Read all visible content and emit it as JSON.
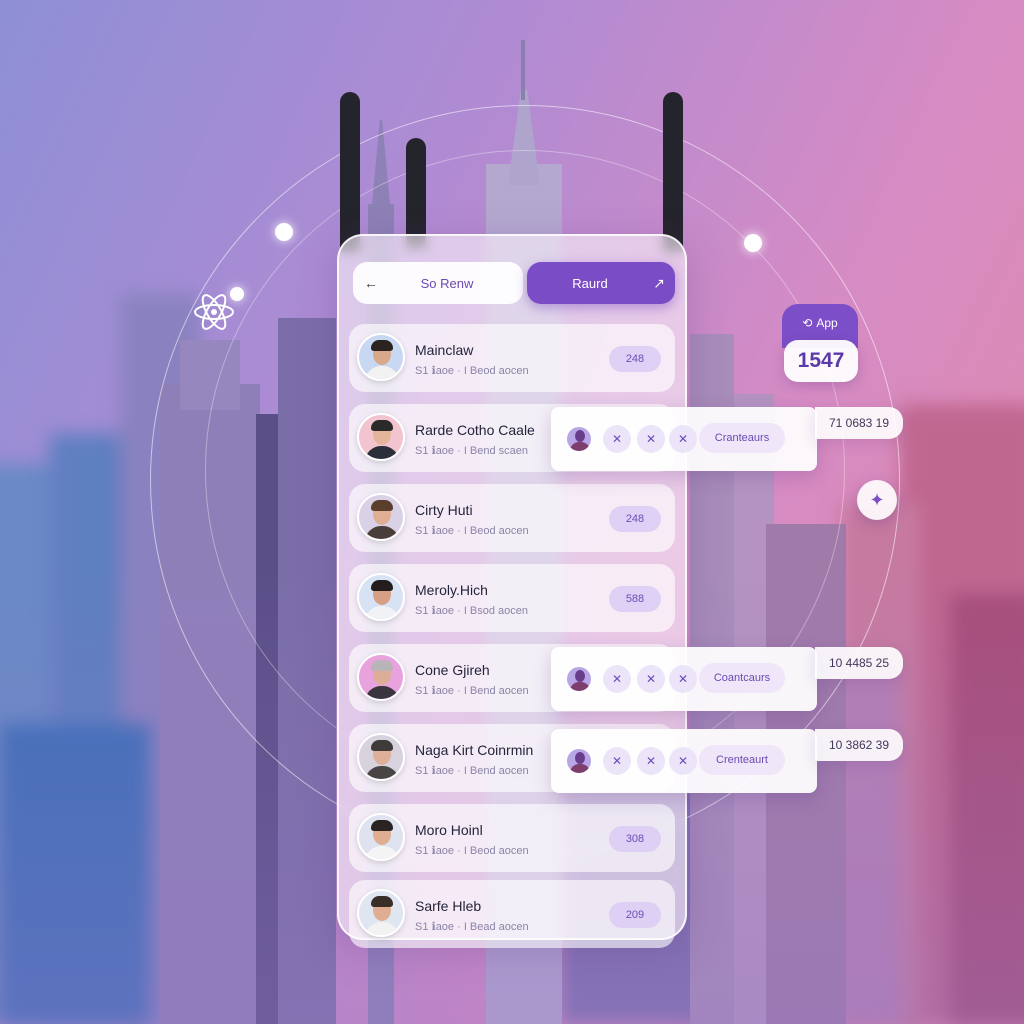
{
  "topbar": {
    "search_icon": "←",
    "search_label": "So Renw",
    "action_label": "Raurd",
    "action_icon": "↗"
  },
  "contacts": [
    {
      "name": "Mainclaw",
      "sub": "S1 ℹaoe · I Beod aocen",
      "badge": "248",
      "avatar_bg": "#c8d8f2",
      "hair": "#2b2320",
      "shirt": "#f2f2f2",
      "skin": "#d9a88a"
    },
    {
      "name": "Rarde Cotho Caale",
      "sub": "S1 ℹaoe · I Bend scaen",
      "badge": "",
      "avatar_bg": "#f1c4cf",
      "hair": "#2a2a2a",
      "shirt": "#2c2e3a",
      "skin": "#e4b59a"
    },
    {
      "name": "Cirty Huti",
      "sub": "S1 ℹaoe · I Beod aocen",
      "badge": "248",
      "avatar_bg": "#d9d2e6",
      "hair": "#5b3f2c",
      "shirt": "#4a3e3a",
      "skin": "#e0ae94"
    },
    {
      "name": "Meroly.Hich",
      "sub": "S1 ℹaoe · I Bsod aocen",
      "badge": "588",
      "avatar_bg": "#d7e3f4",
      "hair": "#231e1d",
      "shirt": "#f1f2f6",
      "skin": "#d7a084"
    },
    {
      "name": "Cone Gjireh",
      "sub": "S1 ℹaoe · I Bend aocen",
      "badge": "",
      "avatar_bg": "#e8a2dd",
      "hair": "#b9b4b7",
      "shirt": "#3b3540",
      "skin": "#dcae98"
    },
    {
      "name": "Naga Kirt Coinrmin",
      "sub": "S1 ℹaoe · I Bend aocen",
      "badge": "",
      "avatar_bg": "#d8d2df",
      "hair": "#3e3b3a",
      "shirt": "#4a4545",
      "skin": "#dfb099"
    },
    {
      "name": "Moro Hoinl",
      "sub": "S1 ℹaoe · I Beod aocen",
      "badge": "308",
      "avatar_bg": "#dfe3f0",
      "hair": "#2a2322",
      "shirt": "#f4f4f4",
      "skin": "#dfae92"
    },
    {
      "name": "Sarfe Hleb",
      "sub": "S1 ℹaoe · I Bead aocen",
      "badge": "209",
      "avatar_bg": "#dfe6f2",
      "hair": "#3a2e29",
      "shirt": "#f2f2f2",
      "skin": "#dfae92"
    }
  ],
  "float_bars": [
    {
      "x_icon": "✕",
      "pill": "Cranteaurs",
      "ext_value": "71 0683 19"
    },
    {
      "x_icon": "✕",
      "pill": "Coantcaurs",
      "ext_value": "10 4485 25"
    },
    {
      "x_icon": "✕",
      "pill": "Crenteaurt",
      "ext_value": "10 3862 39"
    }
  ],
  "app_widget": {
    "icon": "⟲",
    "label": "App",
    "count": "1547"
  },
  "fab_icon": "✦",
  "colors": {
    "accent": "#7a4dc6",
    "badge_bg": "#dccdf5",
    "text": "#24243a"
  }
}
